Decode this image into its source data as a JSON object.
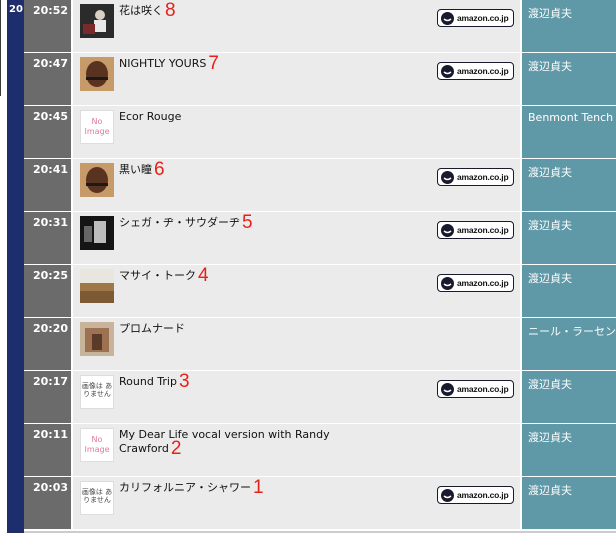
{
  "hour": "20",
  "amazon_label": "amazon.co.jp",
  "rows": [
    {
      "time": "20:52",
      "title": "花は咲く",
      "num": "8",
      "artist": "渡辺貞夫",
      "thumb": "album-photo-icon",
      "amazon": true
    },
    {
      "time": "20:47",
      "title": "NIGHTLY   YOURS",
      "num": "7",
      "artist": "渡辺貞夫",
      "thumb": "album-photo-icon",
      "amazon": true
    },
    {
      "time": "20:45",
      "title": "Ecor Rouge",
      "num": "",
      "artist": "Benmont Tench",
      "thumb": "no-image-icon",
      "noimage_text": "No Image",
      "amazon": false
    },
    {
      "time": "20:41",
      "title": "黒い瞳",
      "num": "6",
      "artist": "渡辺貞夫",
      "thumb": "album-photo-icon",
      "amazon": true
    },
    {
      "time": "20:31",
      "title": "シェガ・ヂ・サウダーヂ",
      "num": "5",
      "artist": "渡辺貞夫",
      "thumb": "album-photo-icon",
      "amazon": true
    },
    {
      "time": "20:25",
      "title": "マサイ・トーク",
      "num": "4",
      "artist": "渡辺貞夫",
      "thumb": "album-photo-icon",
      "amazon": true
    },
    {
      "time": "20:20",
      "title": "プロムナード",
      "num": "",
      "artist": "ニール・ラーセン",
      "thumb": "album-photo-icon",
      "amazon": false
    },
    {
      "time": "20:17",
      "title": "Round Trip",
      "num": "3",
      "artist": "渡辺貞夫",
      "thumb": "no-image-jp-icon",
      "noimage_text": "画像は ありません",
      "amazon": true
    },
    {
      "time": "20:11",
      "title": "My Dear Life vocal version with Randy Crawford",
      "num": "2",
      "artist": "渡辺貞夫",
      "thumb": "no-image-icon",
      "noimage_text": "No Image",
      "amazon": false
    },
    {
      "time": "20:03",
      "title": "カリフォルニア・シャワー",
      "num": "1",
      "artist": "渡辺貞夫",
      "thumb": "no-image-jp-icon",
      "noimage_text": "画像は ありません",
      "amazon": true
    }
  ],
  "colors": {
    "hour_bar": "#1e2d6b",
    "time_cell": "#6b6b6b",
    "main_cell": "#ebebeb",
    "artist_cell": "#5f98a6",
    "number": "#e8201a"
  }
}
